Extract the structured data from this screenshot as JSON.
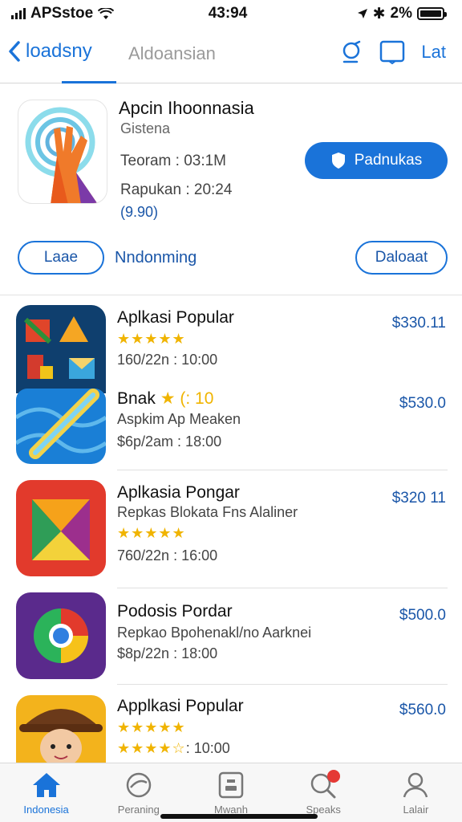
{
  "status": {
    "carrier": "APSstoe",
    "time": "43:94",
    "battery": "2%"
  },
  "nav": {
    "back_label": "loadsny",
    "tab2_label": "Aldoansian",
    "right_label": "Lat"
  },
  "hero": {
    "title": "Apcin Ihoonnasia",
    "subtitle": "Gistena",
    "meta1": "Teoram : 03:1M",
    "meta2": "Rapukan : 20:24",
    "meta3": "(9.90)",
    "get_label": "Padnukas",
    "pill_left": "Laae",
    "mid_link": "Nndonming",
    "pill_right": "Daloaat"
  },
  "list": [
    {
      "name": "Aplkasi Popular",
      "stars": "★★★★★",
      "meta": "160/22n : 10:00",
      "price": "$330.11"
    },
    {
      "name": "Bnak",
      "rating_text": "★ (: 10",
      "desc": "Aspkim Ap Meaken",
      "meta": "$6p/2am : 18:00",
      "price": "$530.0"
    },
    {
      "name": "Aplkasia Pongar",
      "desc": "Repkas Blokata Fns Alaliner",
      "stars": "★★★★★",
      "meta": "760/22n : 16:00",
      "price": "$320 11"
    },
    {
      "name": "Podosis Pordar",
      "desc": "Repkao Bpohenakl/no Aarknei",
      "meta": "$8p/22n : 18:00",
      "price": "$500.0"
    },
    {
      "name": "Applkasi Popular",
      "stars": "★★★★★",
      "meta_stars": "★★★★☆",
      "meta": ": 10:00",
      "price": "$560.0"
    }
  ],
  "tabbar": [
    {
      "label": "Indonesia",
      "icon": "home-icon"
    },
    {
      "label": "Peraning",
      "icon": "compass-icon"
    },
    {
      "label": "Mwanh",
      "icon": "apps-icon"
    },
    {
      "label": "Speaks",
      "icon": "search-icon"
    },
    {
      "label": "Lalair",
      "icon": "person-icon"
    }
  ],
  "colors": {
    "accent": "#1a73d9",
    "star": "#f0b400",
    "badge": "#e53935"
  }
}
